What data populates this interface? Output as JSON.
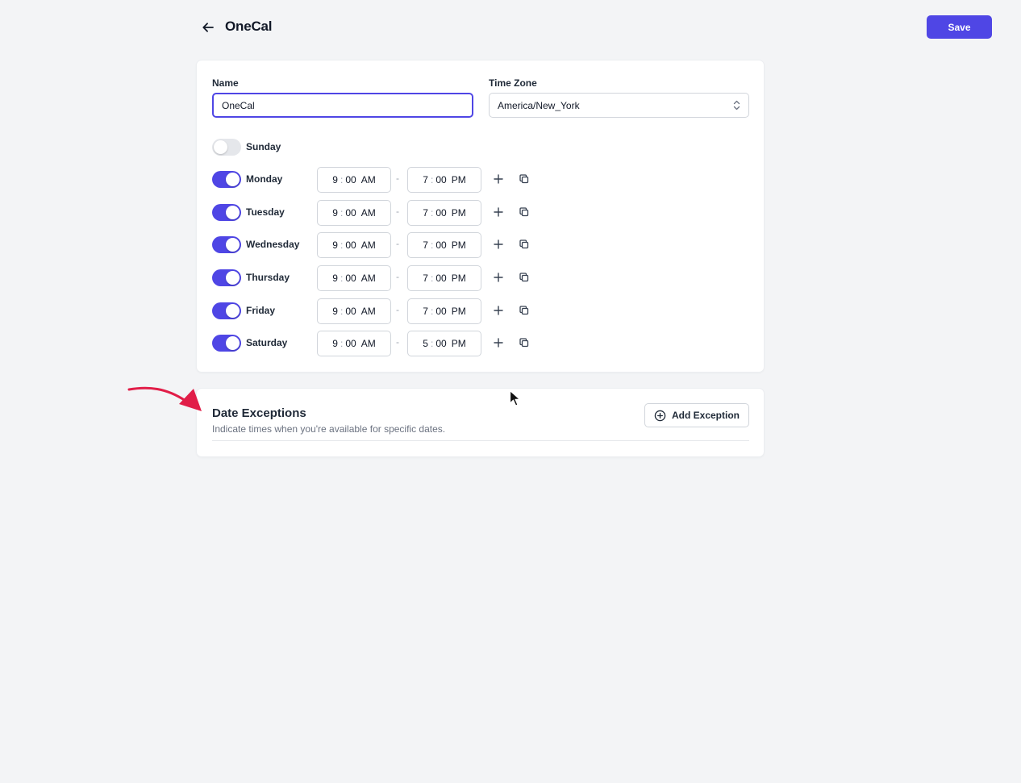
{
  "header": {
    "title": "OneCal",
    "save_label": "Save"
  },
  "form": {
    "name_label": "Name",
    "name_value": "OneCal",
    "timezone_label": "Time Zone",
    "timezone_value": "America/New_York"
  },
  "days": [
    {
      "name": "Sunday",
      "enabled": false
    },
    {
      "name": "Monday",
      "enabled": true,
      "start": {
        "h": "9",
        "m": "00",
        "p": "AM"
      },
      "end": {
        "h": "7",
        "m": "00",
        "p": "PM"
      }
    },
    {
      "name": "Tuesday",
      "enabled": true,
      "start": {
        "h": "9",
        "m": "00",
        "p": "AM"
      },
      "end": {
        "h": "7",
        "m": "00",
        "p": "PM"
      }
    },
    {
      "name": "Wednesday",
      "enabled": true,
      "start": {
        "h": "9",
        "m": "00",
        "p": "AM"
      },
      "end": {
        "h": "7",
        "m": "00",
        "p": "PM"
      }
    },
    {
      "name": "Thursday",
      "enabled": true,
      "start": {
        "h": "9",
        "m": "00",
        "p": "AM"
      },
      "end": {
        "h": "7",
        "m": "00",
        "p": "PM"
      }
    },
    {
      "name": "Friday",
      "enabled": true,
      "start": {
        "h": "9",
        "m": "00",
        "p": "AM"
      },
      "end": {
        "h": "7",
        "m": "00",
        "p": "PM"
      }
    },
    {
      "name": "Saturday",
      "enabled": true,
      "start": {
        "h": "9",
        "m": "00",
        "p": "AM"
      },
      "end": {
        "h": "5",
        "m": "00",
        "p": "PM"
      }
    }
  ],
  "time_separator": ":",
  "range_separator": "-",
  "exceptions": {
    "title": "Date Exceptions",
    "subtitle": "Indicate times when you're available for specific dates.",
    "add_label": "Add Exception"
  },
  "icons": {
    "back": "arrow-left-icon",
    "add_slot": "plus-icon",
    "copy_slot": "copy-icon",
    "add_exception": "plus-circle-icon",
    "timezone_chevrons": "chevron-up-down-icon"
  },
  "colors": {
    "accent": "#4f46e5",
    "background": "#f3f4f6",
    "annotation": "#e11d48"
  }
}
